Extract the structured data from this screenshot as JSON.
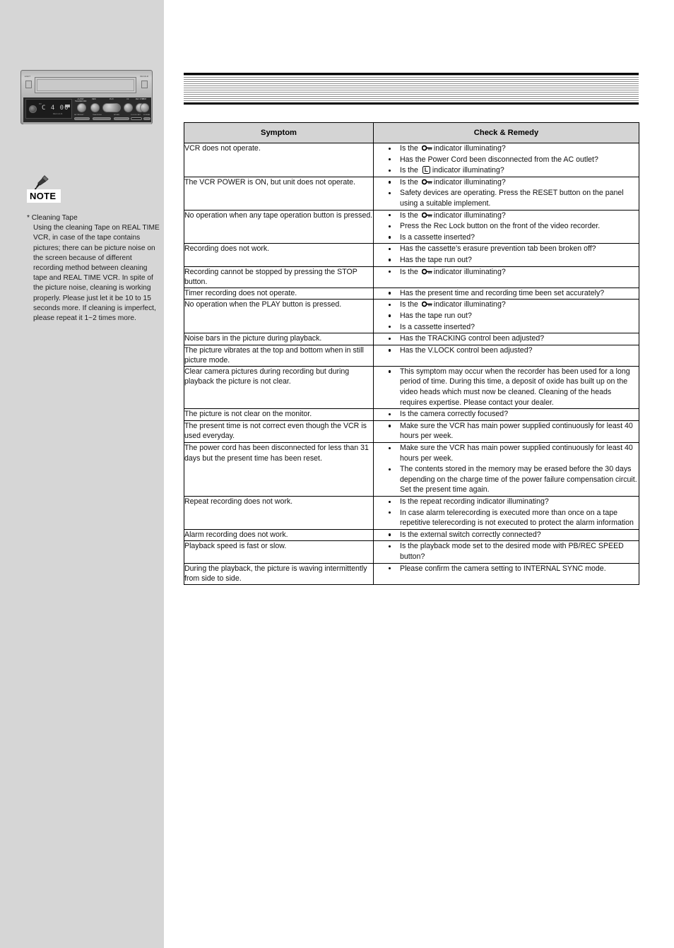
{
  "sidebar": {
    "device_illustration": {
      "name": "vcr-front-panel",
      "left_button_label": "EJECT",
      "right_button_label": "REC/ALM",
      "lcd_time": "C 4  00",
      "lcd_tag": "PM",
      "lcd_sub": "REC/ALM",
      "knob_labels": [
        "ALARM/ TELERECORD",
        "REW",
        "PLAY",
        "FF",
        "REC STOP",
        "STOP"
      ],
      "mini_labels": [
        "SET/RESET",
        "TRACKING",
        "SPEED",
        "CLOCK SET",
        "POWER"
      ]
    },
    "note": {
      "badge": "NOTE",
      "star_title": "* Cleaning Tape",
      "body": "Using the cleaning Tape on REAL TIME VCR, in case of the tape contains pictures; there can be picture noise on the screen because of different recording method between cleaning tape and REAL TIME VCR. In spite of the picture noise, cleaning is working properly. Please just let it be 10 to 15 seconds more. If cleaning is imperfect, please repeat it 1~2 times more."
    }
  },
  "banner": {
    "name": "blanked-title-banner",
    "description": "striped horizontal-rule banner"
  },
  "table": {
    "headers": {
      "symptom": "Symptom",
      "remedy": "Check & Remedy"
    },
    "rows": [
      {
        "symptom": "VCR does not operate.",
        "remedies": [
          {
            "pre": "Is the ",
            "icon": "key",
            "post": "indicator illuminating?"
          },
          {
            "pre": "Has the Power Cord been disconnected from the AC outlet?"
          },
          {
            "pre": "Is the ",
            "icon": "lockbox",
            "post": "indicator illuminating?"
          }
        ]
      },
      {
        "symptom": "The VCR POWER is ON, but unit does not operate.",
        "remedies": [
          {
            "pre": "Is the ",
            "icon": "key",
            "post": "indicator illuminating?"
          },
          {
            "pre": "Safety devices are operating. Press the RESET button on the panel using a suitable implement."
          }
        ]
      },
      {
        "symptom": "No operation when any tape operation button is pressed.",
        "remedies": [
          {
            "pre": "Is the ",
            "icon": "key",
            "post": "indicator illuminating?"
          },
          {
            "pre": "Press the Rec Lock button on the front of the video recorder."
          },
          {
            "pre": "Is a cassette inserted?"
          }
        ]
      },
      {
        "symptom": "Recording does not work.",
        "remedies": [
          {
            "pre": "Has the cassette’s erasure prevention tab been broken off?"
          },
          {
            "pre": "Has the tape run out?"
          }
        ]
      },
      {
        "symptom": "Recording cannot be stopped by pressing the STOP button.",
        "remedies": [
          {
            "pre": "Is the ",
            "icon": "key",
            "post": "indicator illuminating?"
          }
        ]
      },
      {
        "symptom": "Timer recording does not operate.",
        "remedies": [
          {
            "pre": "Has the present time and recording time been set accurately?"
          }
        ]
      },
      {
        "symptom": "No operation when the PLAY button is pressed.",
        "remedies": [
          {
            "pre": "Is the ",
            "icon": "key",
            "post": "indicator illuminating?"
          },
          {
            "pre": "Has the tape run out?"
          },
          {
            "pre": "Is a cassette inserted?"
          }
        ]
      },
      {
        "symptom": "Noise bars in the picture during playback.",
        "remedies": [
          {
            "pre": "Has the TRACKING control been adjusted?"
          }
        ]
      },
      {
        "symptom": "The picture vibrates at the top and bottom when in still picture mode.",
        "remedies": [
          {
            "pre": "Has the V.LOCK control been adjusted?"
          }
        ]
      },
      {
        "symptom": "Clear camera pictures during recording but during playback the picture is not clear.",
        "remedies": [
          {
            "pre": "This symptom may occur when the recorder has been used for a long period of time. During this time, a deposit of oxide has built up on the video heads which must now be cleaned. Cleaning of the heads requires expertise. Please contact your dealer."
          }
        ]
      },
      {
        "symptom": "The picture is not clear on the monitor.",
        "remedies": [
          {
            "pre": "Is the camera correctly focused?"
          }
        ]
      },
      {
        "symptom": "The present time is not correct even though the VCR is used everyday.",
        "remedies": [
          {
            "pre": "Make sure the VCR has main power supplied continuously for least 40 hours per week."
          }
        ]
      },
      {
        "symptom": "The power cord has been disconnected for less than 31 days but the present time has been reset.",
        "remedies": [
          {
            "pre": "Make sure the VCR has main power supplied continuously for least 40 hours per week."
          },
          {
            "pre": "The contents stored in the memory may be erased before the 30 days depending on the charge time of the power failure compensation circuit. Set the present time again."
          }
        ]
      },
      {
        "symptom": "Repeat recording does not work.",
        "remedies": [
          {
            "pre": "Is the repeat recording indicator illuminating?"
          },
          {
            "pre": "In case alarm telerecording is executed more than once on a tape repetitive telerecording is not executed to protect the alarm information"
          }
        ]
      },
      {
        "symptom": "Alarm recording does not work.",
        "remedies": [
          {
            "pre": "Is the external switch correctly connected?"
          }
        ]
      },
      {
        "symptom": "Playback speed is fast or slow.",
        "remedies": [
          {
            "pre": "Is the playback mode set to the desired mode with PB/REC SPEED button?"
          }
        ]
      },
      {
        "symptom": "During the playback, the picture is waving intermittently from side to side.",
        "remedies": [
          {
            "pre": "Please confirm the camera setting to INTERNAL SYNC mode."
          }
        ]
      }
    ]
  },
  "colors": {
    "sidebar_bg": "#d6d6d6",
    "header_bg": "#d4d4d4",
    "border": "#000000",
    "text": "#111111"
  }
}
